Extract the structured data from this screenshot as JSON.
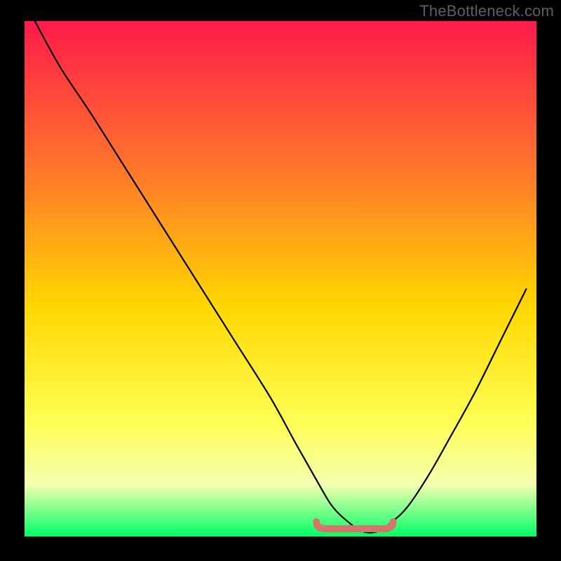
{
  "attribution": "TheBottleneck.com",
  "colors": {
    "gradient_top": "#ff1a4b",
    "gradient_mid1": "#ff7a2a",
    "gradient_mid2": "#ffd600",
    "gradient_mid3": "#ffff55",
    "gradient_mid4": "#f3ffaf",
    "gradient_bottom": "#00ff66",
    "curve": "#000000",
    "marker": "#d6756b",
    "frame": "#000000"
  },
  "chart_data": {
    "type": "line",
    "title": "",
    "xlabel": "",
    "ylabel": "",
    "xlim": [
      0,
      100
    ],
    "ylim": [
      0,
      100
    ],
    "series": [
      {
        "name": "bottleneck-curve",
        "x": [
          2,
          7,
          13,
          20,
          27,
          34,
          41,
          48,
          53,
          57,
          60,
          63,
          66,
          69,
          72,
          75,
          79,
          83,
          88,
          93,
          98
        ],
        "values": [
          100,
          91,
          82,
          71,
          60,
          49,
          38,
          27,
          18,
          11,
          6,
          3,
          1,
          1,
          3,
          6,
          12,
          19,
          28,
          38,
          48
        ]
      }
    ],
    "marker_segment": {
      "name": "optimal-range",
      "x_start": 57,
      "x_end": 72,
      "y": 1.5
    }
  }
}
